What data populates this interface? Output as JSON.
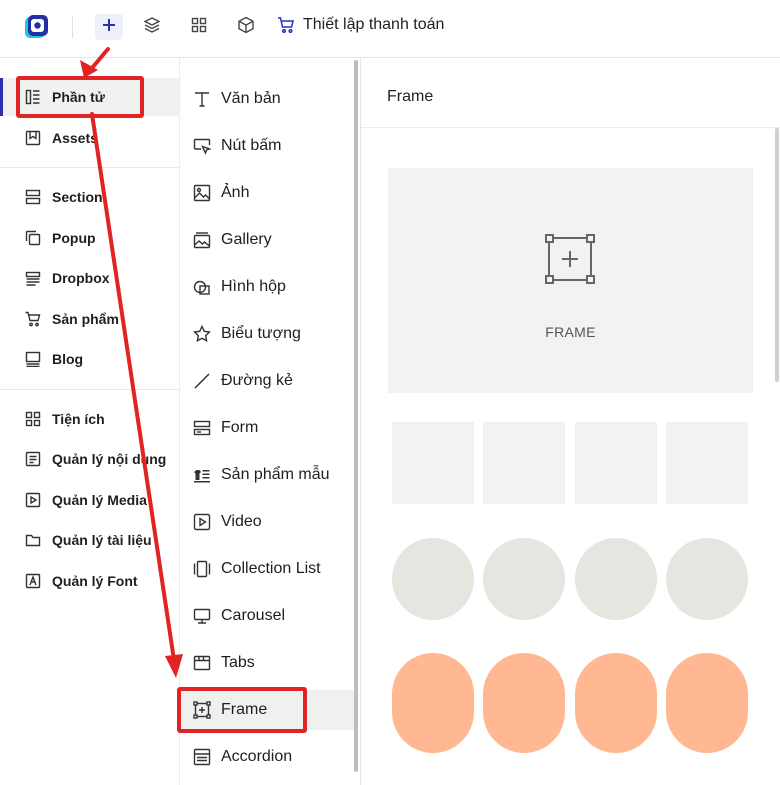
{
  "topbar": {
    "checkout_label": "Thiết lập thanh toán",
    "icons": [
      "logo-icon",
      "plus-icon",
      "layers-icon",
      "grid-icon",
      "box-icon",
      "cart-icon"
    ],
    "accent": "#2d2fb3"
  },
  "sidebar": {
    "items": [
      {
        "label": "Phần tử",
        "icon": "elements-icon"
      },
      {
        "label": "Assets",
        "icon": "bookmark-icon"
      },
      {
        "label": "Section",
        "icon": "section-icon"
      },
      {
        "label": "Popup",
        "icon": "popup-icon"
      },
      {
        "label": "Dropbox",
        "icon": "dropbox-icon"
      },
      {
        "label": "Sản phẩm",
        "icon": "cart-icon"
      },
      {
        "label": "Blog",
        "icon": "blog-icon"
      },
      {
        "label": "Tiện ích",
        "icon": "widgets-icon"
      },
      {
        "label": "Quản lý nội dung",
        "icon": "content-icon"
      },
      {
        "label": "Quản lý Media",
        "icon": "media-icon"
      },
      {
        "label": "Quản lý tài liệu",
        "icon": "folder-icon"
      },
      {
        "label": "Quản lý Font",
        "icon": "font-icon"
      }
    ]
  },
  "elements": {
    "items": [
      {
        "label": "Văn bản",
        "icon": "text-icon"
      },
      {
        "label": "Nút bấm",
        "icon": "button-icon"
      },
      {
        "label": "Ảnh",
        "icon": "image-icon"
      },
      {
        "label": "Gallery",
        "icon": "gallery-icon"
      },
      {
        "label": "Hình hộp",
        "icon": "shape-icon"
      },
      {
        "label": "Biểu tượng",
        "icon": "star-icon"
      },
      {
        "label": "Đường kẻ",
        "icon": "line-icon"
      },
      {
        "label": "Form",
        "icon": "form-icon"
      },
      {
        "label": "Sản phẩm mẫu",
        "icon": "sample-product-icon"
      },
      {
        "label": "Video",
        "icon": "video-icon"
      },
      {
        "label": "Collection List",
        "icon": "collection-icon"
      },
      {
        "label": "Carousel",
        "icon": "carousel-icon"
      },
      {
        "label": "Tabs",
        "icon": "tabs-icon"
      },
      {
        "label": "Frame",
        "icon": "frame-icon"
      },
      {
        "label": "Accordion",
        "icon": "accordion-icon"
      }
    ]
  },
  "preview": {
    "title": "Frame",
    "frame_label": "FRAME",
    "colors": {
      "placeholder": "#f2f2f3",
      "circle": "#e7e5e0",
      "pill": "#ffb891"
    }
  },
  "annotation": {
    "color": "#e02424"
  }
}
